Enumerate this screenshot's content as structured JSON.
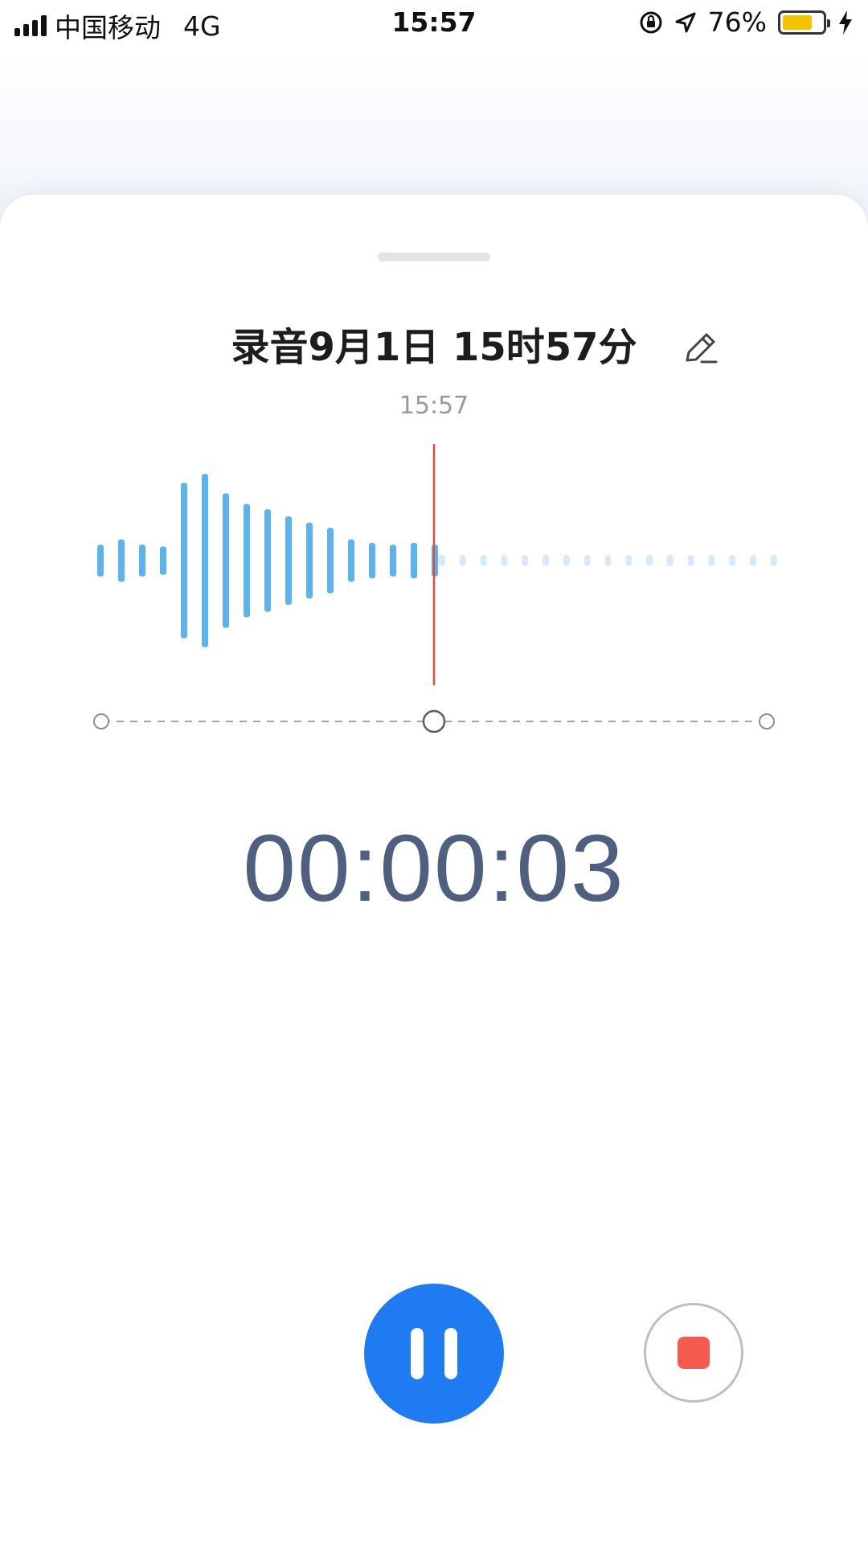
{
  "status_bar": {
    "carrier": "中国移动",
    "network": "4G",
    "time": "15:57",
    "battery_percent": "76%",
    "battery_level": 0.76,
    "icons": [
      "signal-icon",
      "orientation-lock-icon",
      "location-icon",
      "battery-icon",
      "charging-icon"
    ]
  },
  "recording": {
    "title": "录音9月1日 15时57分",
    "start_time": "15:57",
    "elapsed": "00:00:03"
  },
  "waveform": {
    "recorded_levels": [
      0.18,
      0.24,
      0.18,
      0.16,
      0.88,
      0.98,
      0.76,
      0.64,
      0.58,
      0.5,
      0.43,
      0.37,
      0.24,
      0.2,
      0.18,
      0.2,
      0.18
    ],
    "pending_dot_count": 17,
    "recorded_color": "#5ab4f2",
    "pending_color": "#d5ebfb",
    "playhead_color": "#e04b3d"
  },
  "controls": {
    "pause_icon": "pause-icon",
    "stop_icon": "stop-icon",
    "accent": "#1f7bf2",
    "stop_color": "#f55a4e"
  }
}
